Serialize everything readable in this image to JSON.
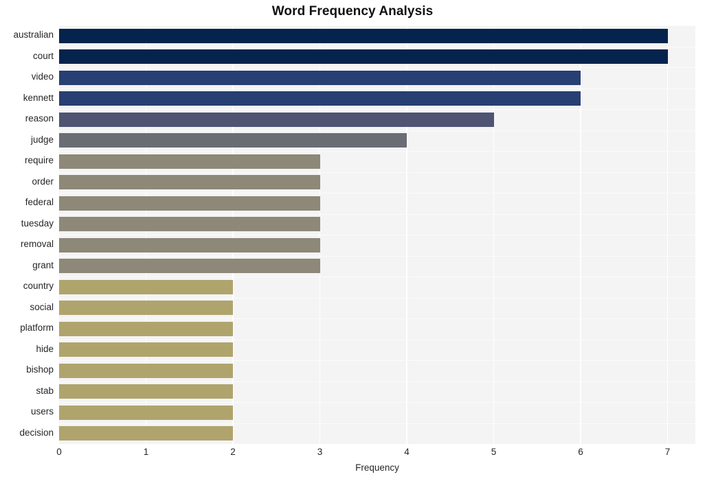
{
  "chart_data": {
    "type": "bar",
    "orientation": "horizontal",
    "title": "Word Frequency Analysis",
    "xlabel": "Frequency",
    "ylabel": "",
    "categories": [
      "australian",
      "court",
      "video",
      "kennett",
      "reason",
      "judge",
      "require",
      "order",
      "federal",
      "tuesday",
      "removal",
      "grant",
      "country",
      "social",
      "platform",
      "hide",
      "bishop",
      "stab",
      "users",
      "decision"
    ],
    "values": [
      7,
      7,
      6,
      6,
      5,
      4,
      3,
      3,
      3,
      3,
      3,
      3,
      2,
      2,
      2,
      2,
      2,
      2,
      2,
      2
    ],
    "bar_colors": [
      "#05244d",
      "#05244d",
      "#273f72",
      "#273f72",
      "#4e5472",
      "#6b6d75",
      "#8e8878",
      "#8e8878",
      "#8e8878",
      "#8e8878",
      "#8e8878",
      "#8e8878",
      "#b0a46d",
      "#b0a46d",
      "#b0a46d",
      "#b0a46d",
      "#b0a46d",
      "#b0a46d",
      "#b0a46d",
      "#b0a46d"
    ],
    "xticks": [
      0,
      1,
      2,
      3,
      4,
      5,
      6,
      7
    ],
    "xtick_labels": [
      "0",
      "1",
      "2",
      "3",
      "4",
      "5",
      "6",
      "7"
    ],
    "xlim": [
      0,
      7.32
    ],
    "grid": true,
    "grid_color": "#ffffff",
    "legend": null,
    "plot_background": "#f4f4f5",
    "figure_background": "#ffffff"
  }
}
